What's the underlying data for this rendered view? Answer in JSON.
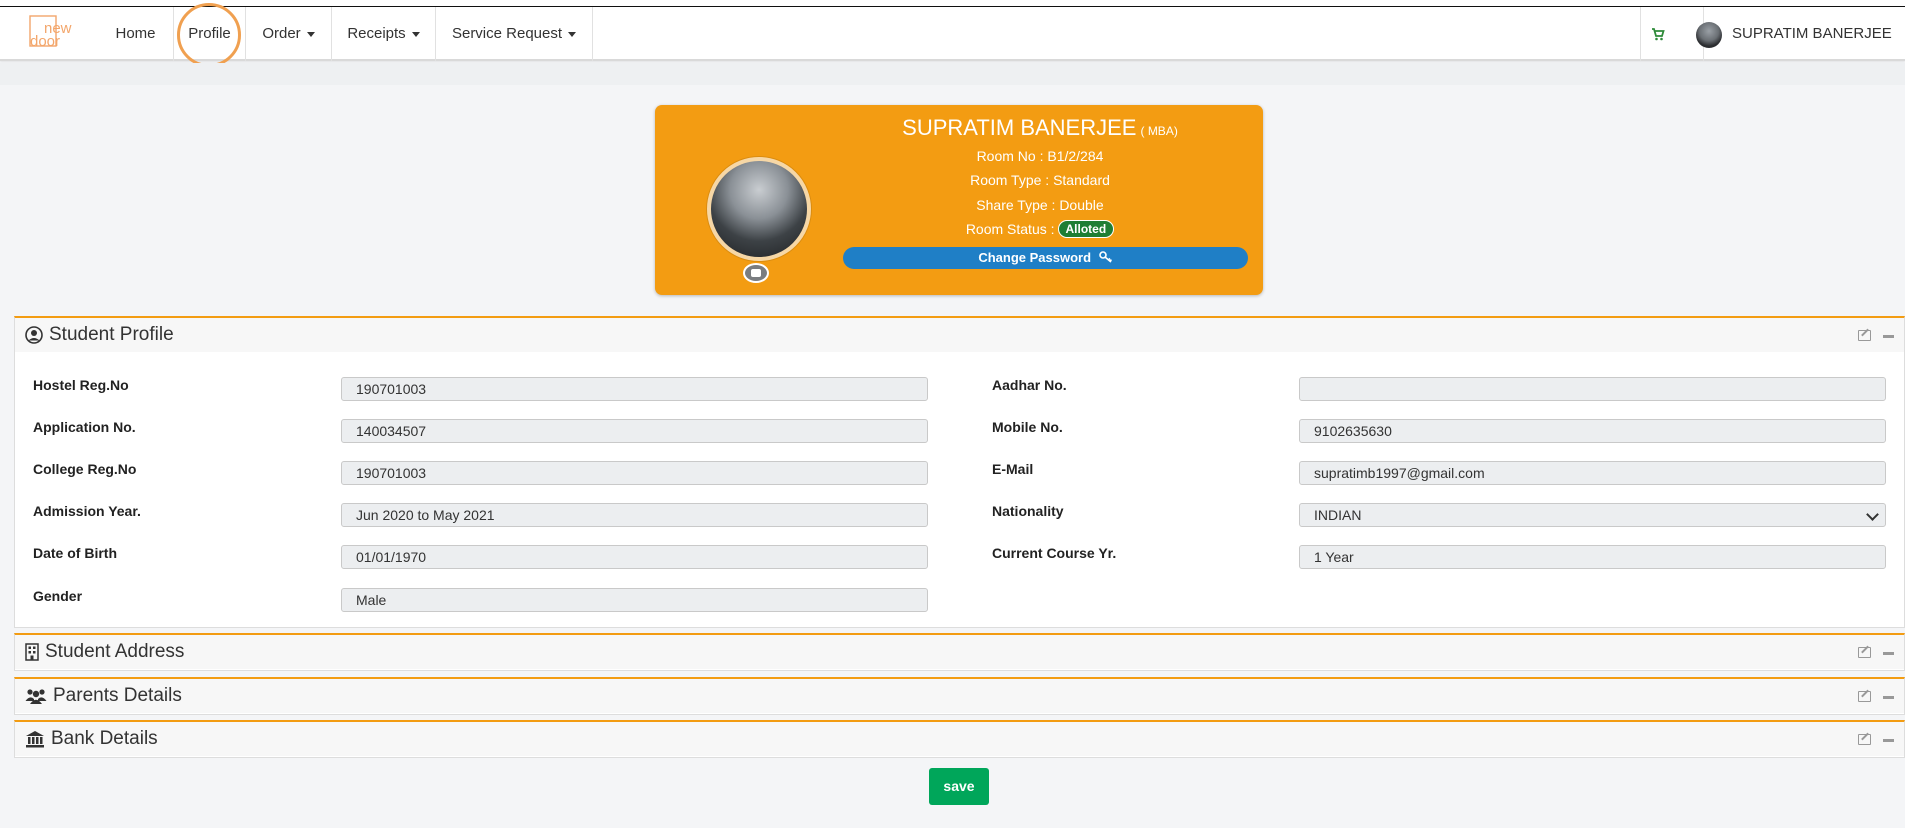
{
  "nav": {
    "logo_line1": "new",
    "logo_line2": "door",
    "items": [
      {
        "label": "Home"
      },
      {
        "label": "Profile"
      },
      {
        "label": "Order"
      },
      {
        "label": "Receipts"
      },
      {
        "label": "Service Request"
      }
    ],
    "user_name": "SUPRATIM BANERJEE"
  },
  "card": {
    "name": "SUPRATIM BANERJEE",
    "course": "( MBA)",
    "room_no": "Room No : B1/2/284",
    "room_type": "Room Type : Standard",
    "share_type": "Share Type : Double",
    "room_status_label": "Room Status :",
    "room_status": "Alloted",
    "change_password": "Change Password"
  },
  "student_profile": {
    "title": "Student Profile",
    "fields": {
      "hostel_reg_label": "Hostel Reg.No",
      "hostel_reg": "190701003",
      "application_label": "Application No.",
      "application": "140034507",
      "college_reg_label": "College Reg.No",
      "college_reg": "190701003",
      "admission_label": "Admission Year.",
      "admission": "Jun 2020 to May 2021",
      "dob_label": "Date of Birth",
      "dob": "01/01/1970",
      "gender_label": "Gender",
      "gender": "Male",
      "aadhar_label": "Aadhar No.",
      "aadhar": "",
      "mobile_label": "Mobile No.",
      "mobile": "9102635630",
      "email_label": "E-Mail",
      "email": "supratimb1997@gmail.com",
      "nationality_label": "Nationality",
      "nationality": "INDIAN",
      "course_yr_label": "Current Course Yr.",
      "course_yr": "1 Year"
    }
  },
  "sections": {
    "address": "Student Address",
    "parents": "Parents Details",
    "bank": "Bank Details"
  },
  "save_label": "save",
  "colors": {
    "accent": "#f39c12",
    "primary": "#1f7fc6",
    "success": "#00a65a",
    "badge": "#1e7e34"
  }
}
